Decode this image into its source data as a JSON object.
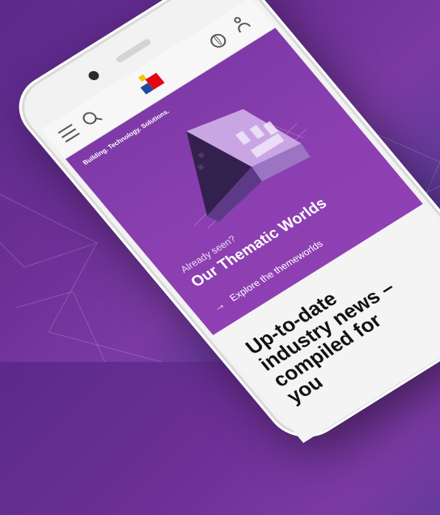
{
  "header": {
    "menu_icon": "menu-icon",
    "search_icon": "search-icon",
    "logo": "logo",
    "language_icon": "globe-icon",
    "account_icon": "user-icon"
  },
  "hero": {
    "tagline": "Building. Technology. Solutions.",
    "eyebrow": "Already seen?",
    "title": "Our Thematic Worlds",
    "link_label": "Explore the themeworlds",
    "arrow": "→"
  },
  "news": {
    "heading": "Up-to-date industry news – compiled for you"
  },
  "colors": {
    "brand_purple": "#8b3fb0",
    "logo_red": "#e30613",
    "logo_blue": "#1d4b9b",
    "logo_yellow": "#f3c300"
  }
}
